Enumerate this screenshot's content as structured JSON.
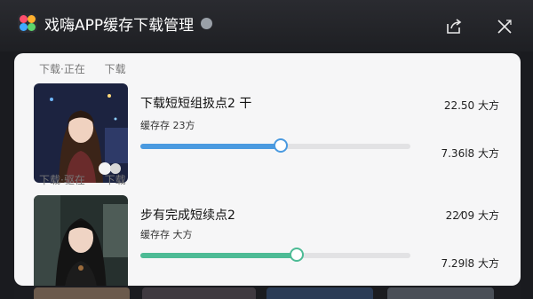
{
  "app": {
    "title": "戏嗨APP缓存下载管理",
    "logo_icon": "multicolor-app-logo",
    "badge_icon": "cloud-badge-icon"
  },
  "toolbar": {
    "share_icon": "share-icon",
    "close_icon": "close-icon"
  },
  "sections": [
    {
      "left": "下载·正在",
      "right": "下载"
    },
    {
      "left": "下载·驱在",
      "right": "下载"
    }
  ],
  "downloads": [
    {
      "title": "下载短短组扱点2 干",
      "subtitle": "缓存存 23方",
      "size": "22.50 大方",
      "speed": "7.36l8 大方",
      "progress": 0.52,
      "color": "#4a9ae0"
    },
    {
      "title": "步有完成短续点2",
      "subtitle": "缓存存 大方",
      "size": "22⁄09 大方",
      "speed": "7.29l8 大方",
      "progress": 0.58,
      "color": "#4dbb95"
    }
  ]
}
